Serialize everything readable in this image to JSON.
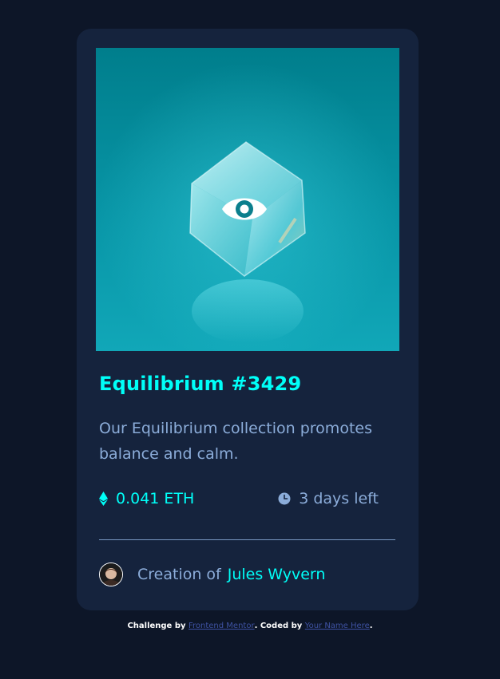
{
  "card": {
    "title": "Equilibrium #3429",
    "description": "Our Equilibrium collection promotes balance and calm.",
    "price": "0.041 ETH",
    "time_left": "3 days left",
    "creator_prefix": "Creation of",
    "creator_name": "Jules Wyvern"
  },
  "attribution": {
    "challenge_by": "Challenge by",
    "frontend_mentor": "Frontend Mentor",
    "coded_by": ". Coded by",
    "your_name": "Your Name Here",
    "end": "."
  },
  "icons": {
    "hero_overlay": "eye-icon",
    "price": "ethereum-icon",
    "time": "clock-icon",
    "avatar": "avatar"
  },
  "colors": {
    "page_bg": "#0d1628",
    "card_bg": "#15233d",
    "cyan": "#00fff8",
    "soft_blue": "#8bacd9",
    "link_blue": "#3e52a3",
    "white": "#ffffff"
  }
}
